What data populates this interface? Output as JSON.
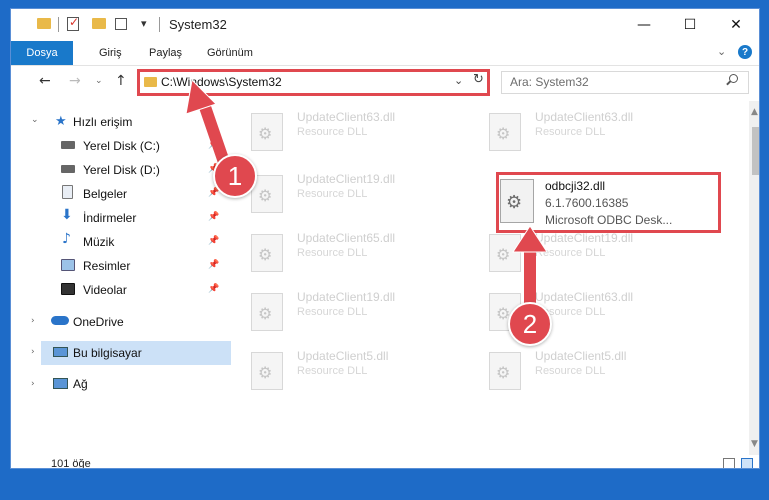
{
  "window": {
    "title": "System32",
    "quick_access_dropdown": "▾",
    "controls": {
      "minimize": "—",
      "maximize": "☐",
      "close": "✕"
    }
  },
  "ribbon": {
    "tabs": [
      "Dosya",
      "Giriş",
      "Paylaş",
      "Görünüm"
    ],
    "expand": "⌄",
    "help": "?"
  },
  "nav": {
    "back": "←",
    "forward": "→",
    "recent": "⌄",
    "up": "↑",
    "address": "C:\\Windows\\System32",
    "address_dropdown": "⌄",
    "refresh": "↻",
    "search_placeholder": "Ara: System32"
  },
  "sidebar": {
    "quick_access": "Hızlı erişim",
    "items": [
      {
        "label": "Yerel Disk (C:)",
        "icon": "drive-icon"
      },
      {
        "label": "Yerel Disk (D:)",
        "icon": "drive-icon"
      },
      {
        "label": "Belgeler",
        "icon": "documents-icon"
      },
      {
        "label": "İndirmeler",
        "icon": "downloads-icon"
      },
      {
        "label": "Müzik",
        "icon": "music-icon"
      },
      {
        "label": "Resimler",
        "icon": "pictures-icon"
      },
      {
        "label": "Videolar",
        "icon": "videos-icon"
      }
    ],
    "onedrive": "OneDrive",
    "this_pc": "Bu bilgisayar",
    "network": "Ağ",
    "pin": "📌",
    "chevron": "›"
  },
  "files": {
    "left_column": [
      {
        "name": "UpdateClient63.dll",
        "type": "Resource DLL"
      },
      {
        "name": "UpdateClient19.dll",
        "type": "Resource DLL"
      },
      {
        "name": "UpdateClient65.dll",
        "type": "Resource DLL"
      },
      {
        "name": "UpdateClient19.dll",
        "type": "Resource DLL"
      },
      {
        "name": "UpdateClient5.dll",
        "type": "Resource DLL"
      }
    ],
    "right_column": [
      {
        "name": "UpdateClient63.dll",
        "type": "Resource DLL"
      },
      {
        "name": "UpdateClient19.dll",
        "type": "Resource DLL"
      },
      {
        "name": "UpdateClient63.dll",
        "type": "Resource DLL"
      },
      {
        "name": "UpdateClient5.dll",
        "type": "Resource DLL"
      }
    ],
    "selected": {
      "name": "odbcji32.dll",
      "version": "6.1.7600.16385",
      "description": "Microsoft ODBC Desk..."
    }
  },
  "status": {
    "count": "101 öğe"
  },
  "annotations": {
    "step1": "1",
    "step2": "2",
    "color": "#e0484f"
  },
  "colors": {
    "desktop": "#1e6bc7",
    "accent": "#1979ca",
    "selection": "#cce1f7"
  }
}
